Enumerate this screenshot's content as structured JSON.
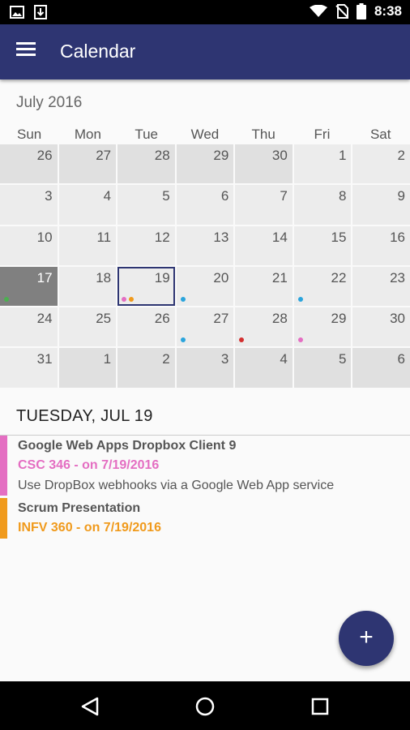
{
  "status_bar": {
    "time": "8:38",
    "icons": [
      "image-icon",
      "download-icon",
      "wifi-icon",
      "no-sim-icon",
      "battery-icon"
    ]
  },
  "app_bar": {
    "title": "Calendar",
    "menu_icon": "hamburger-menu-icon",
    "color": "#2e3572"
  },
  "calendar": {
    "month_label": "July 2016",
    "weekdays": [
      "Sun",
      "Mon",
      "Tue",
      "Wed",
      "Thu",
      "Fri",
      "Sat"
    ],
    "weeks": [
      [
        {
          "day": "26",
          "other": true
        },
        {
          "day": "27",
          "other": true
        },
        {
          "day": "28",
          "other": true
        },
        {
          "day": "29",
          "other": true
        },
        {
          "day": "30",
          "other": true
        },
        {
          "day": "1"
        },
        {
          "day": "2"
        }
      ],
      [
        {
          "day": "3"
        },
        {
          "day": "4"
        },
        {
          "day": "5"
        },
        {
          "day": "6"
        },
        {
          "day": "7"
        },
        {
          "day": "8"
        },
        {
          "day": "9"
        }
      ],
      [
        {
          "day": "10"
        },
        {
          "day": "11"
        },
        {
          "day": "12"
        },
        {
          "day": "13"
        },
        {
          "day": "14"
        },
        {
          "day": "15"
        },
        {
          "day": "16"
        }
      ],
      [
        {
          "day": "17",
          "today": true,
          "dots": [
            "#4caf50"
          ]
        },
        {
          "day": "18"
        },
        {
          "day": "19",
          "selected": true,
          "dots": [
            "#e46ec2",
            "#f09a1c"
          ]
        },
        {
          "day": "20",
          "dots": [
            "#2aa4dc"
          ]
        },
        {
          "day": "21"
        },
        {
          "day": "22",
          "dots": [
            "#2aa4dc"
          ]
        },
        {
          "day": "23"
        }
      ],
      [
        {
          "day": "24"
        },
        {
          "day": "25"
        },
        {
          "day": "26"
        },
        {
          "day": "27",
          "dots": [
            "#2aa4dc"
          ]
        },
        {
          "day": "28",
          "dots": [
            "#d32f2f"
          ]
        },
        {
          "day": "29",
          "dots": [
            "#e46ec2"
          ]
        },
        {
          "day": "30"
        }
      ],
      [
        {
          "day": "31"
        },
        {
          "day": "1",
          "other": true
        },
        {
          "day": "2",
          "other": true
        },
        {
          "day": "3",
          "other": true
        },
        {
          "day": "4",
          "other": true
        },
        {
          "day": "5",
          "other": true
        },
        {
          "day": "6",
          "other": true
        }
      ]
    ]
  },
  "agenda": {
    "day_header": "TUESDAY, JUL 19",
    "events": [
      {
        "title": "Google Web Apps Dropbox Client 9",
        "course": "CSC 346 - on 7/19/2016",
        "description": "Use DropBox webhooks via a Google Web App service",
        "color": "#e46ec2"
      },
      {
        "title": "Scrum Presentation",
        "course": "INFV 360 - on 7/19/2016",
        "description": "",
        "color": "#f09a1c"
      }
    ]
  },
  "fab": {
    "label": "+",
    "icon": "add-icon"
  },
  "nav_bar": {
    "icons": [
      "back-icon",
      "home-icon",
      "recents-icon"
    ]
  }
}
